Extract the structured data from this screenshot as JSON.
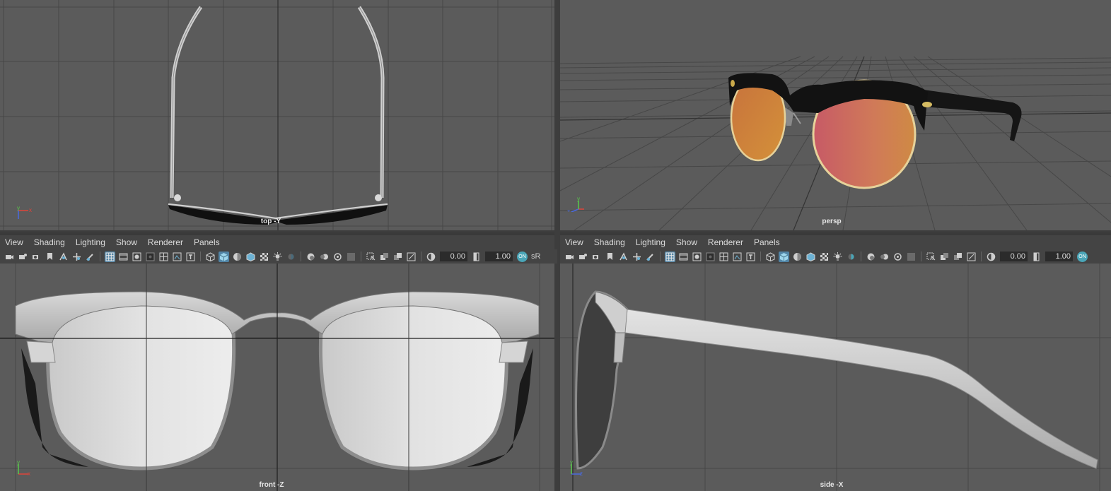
{
  "viewports": {
    "top": {
      "camera_label": "top -Y"
    },
    "persp": {
      "camera_label": "persp"
    },
    "front": {
      "camera_label": "front -Z"
    },
    "side": {
      "camera_label": "side -X"
    }
  },
  "panel_menu": {
    "view": "View",
    "shading": "Shading",
    "lighting": "Lighting",
    "show": "Show",
    "renderer": "Renderer",
    "panels": "Panels"
  },
  "toolbar": {
    "exposure_value": "0.00",
    "gamma_value": "1.00",
    "color_mgmt_badge": "ON",
    "view_transform": "sR"
  },
  "axis": {
    "x": "x",
    "y": "y",
    "z": "z"
  },
  "colors": {
    "viewport_bg": "#5b5b5b",
    "grid": "#444444",
    "menubar_bg": "#444444",
    "selected_icon": "#5285a6",
    "frame_black": "#121212",
    "lens_orange": "#d9843a",
    "lens_pink": "#c96a6a",
    "rim_gold": "#e6d29a",
    "axis_x": "#e0443a",
    "axis_y": "#58c94a",
    "axis_z": "#4a6ae0"
  }
}
